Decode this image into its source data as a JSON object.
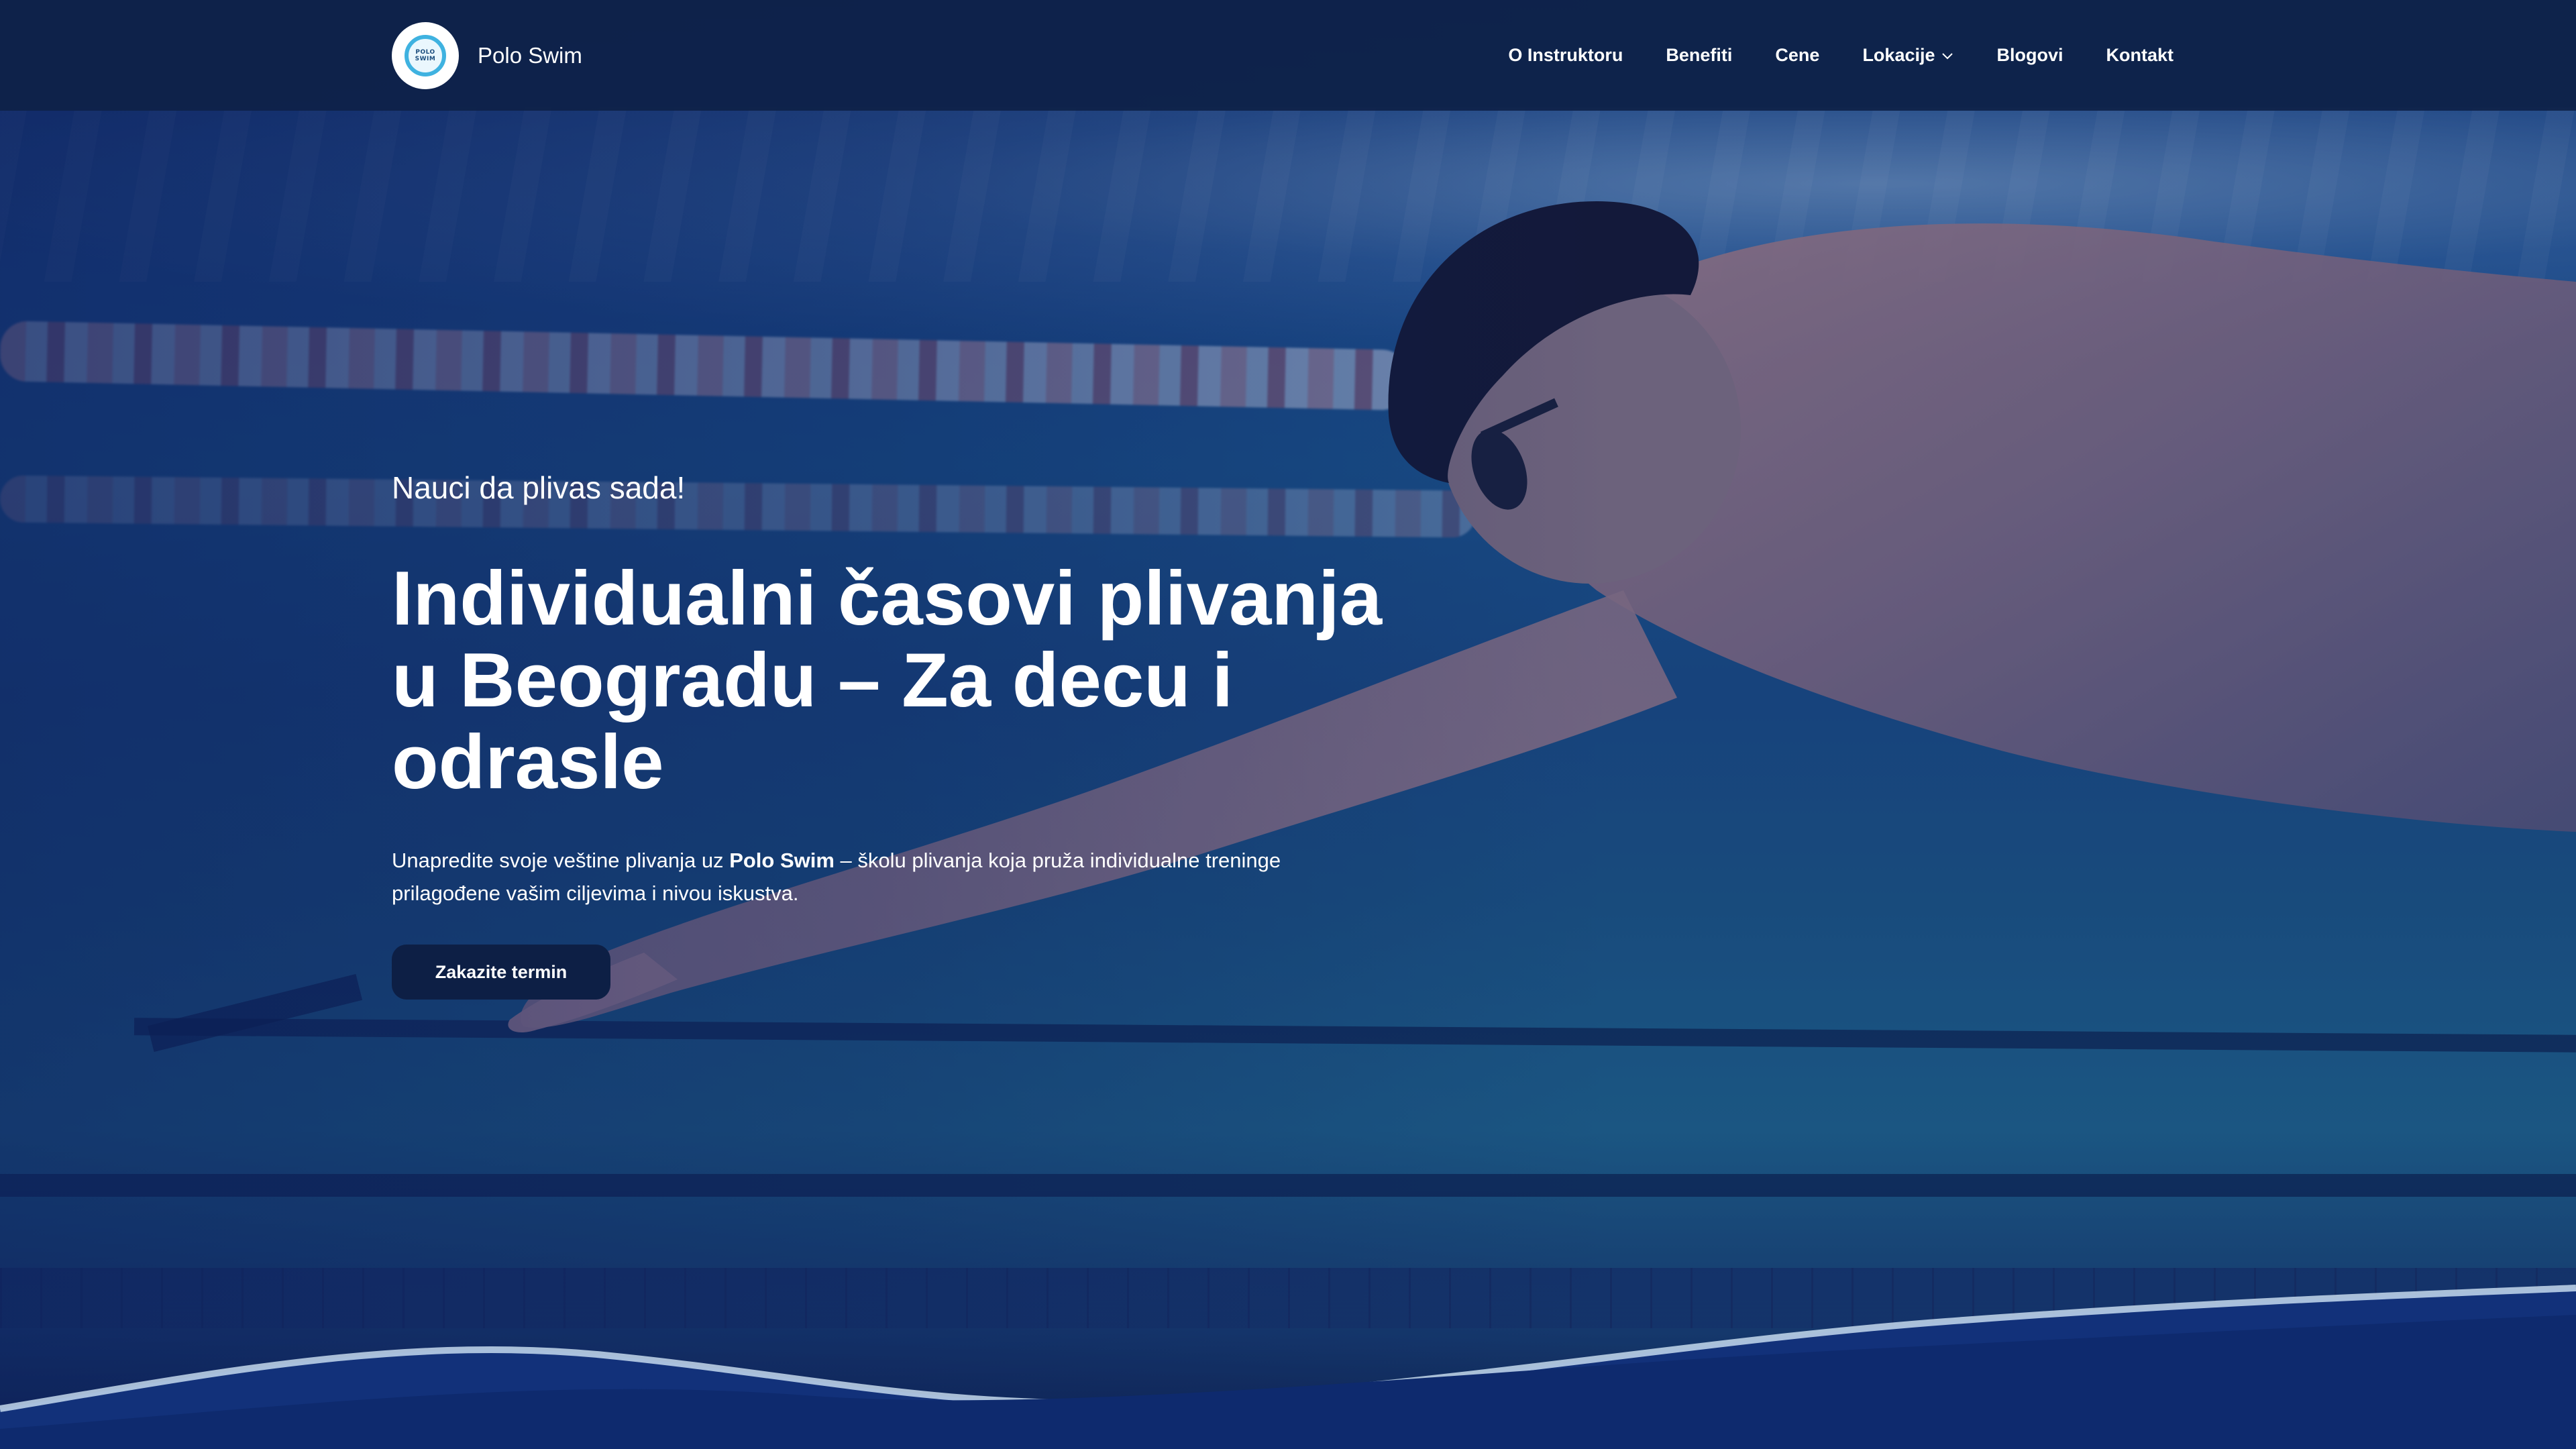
{
  "brand": {
    "name": "Polo Swim",
    "logo_text_top": "POLO",
    "logo_text_bottom": "SWIM"
  },
  "nav": {
    "items": [
      {
        "label": "O Instruktoru"
      },
      {
        "label": "Benefiti"
      },
      {
        "label": "Cene"
      },
      {
        "label": "Lokacije",
        "icon": "chevron-down-icon"
      },
      {
        "label": "Blogovi"
      },
      {
        "label": "Kontakt"
      }
    ]
  },
  "hero": {
    "eyebrow": "Nauci da plivas sada!",
    "headline": "Individualni časovi plivanja u Beogradu – Za decu i odrasle",
    "lead_before": "Unapredite svoje veštine plivanja uz ",
    "lead_brand": "Polo Swim",
    "lead_after": " – školu plivanja koja pruža individualne treninge prilagođene vašim ciljevima i nivou iskustva.",
    "cta_label": "Zakazite termin"
  },
  "colors": {
    "navbar_bg": "#0e2148",
    "cta_bg": "#0d1f45",
    "logo_ring": "#3fb2e0",
    "text": "#ffffff"
  }
}
